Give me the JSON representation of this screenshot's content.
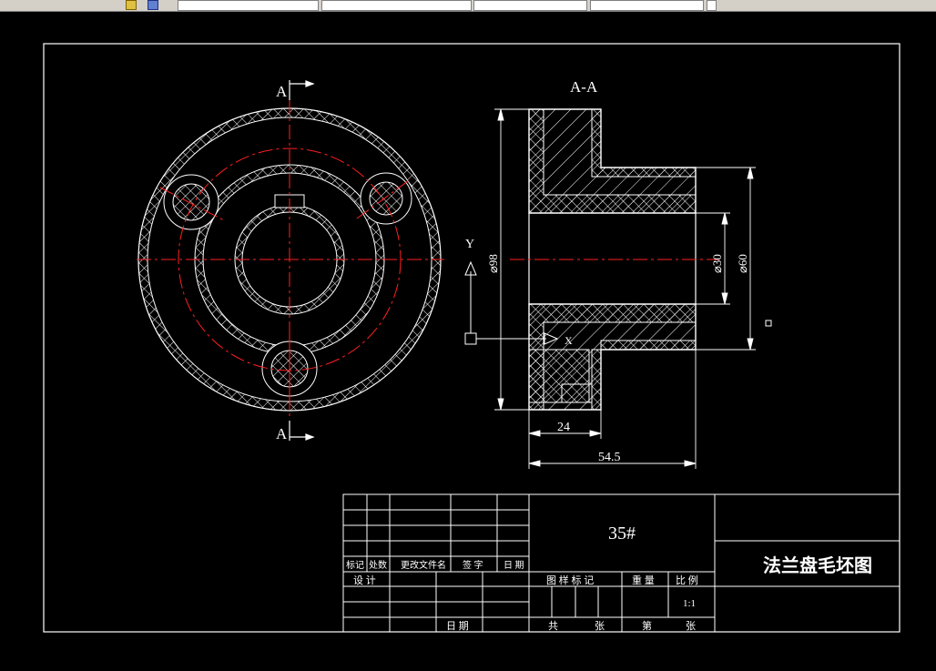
{
  "toolbar": {
    "fields": [
      "",
      "",
      "",
      "",
      ""
    ],
    "icons": [
      "layer-tool-icon",
      "cube-icon"
    ]
  },
  "drawing": {
    "section_label_top": "A",
    "section_label_bottom": "A",
    "section_view_title": "A-A",
    "ucs_y_label": "Y",
    "ucs_x_label": "X",
    "dimensions": {
      "outer_diameter": "⌀98",
      "bore_diameter": "⌀30",
      "hub_diameter": "⌀60",
      "flange_width": "24",
      "total_length": "54.5"
    },
    "colors": {
      "background": "#000000",
      "lines": "#ffffff",
      "centerlines": "#ff0000"
    }
  },
  "title_block": {
    "material": "35#",
    "drawing_name": "法兰盘毛坯图",
    "header_row": [
      "标记",
      "处数",
      "更改文件名",
      "签 字",
      "日 期"
    ],
    "design_label": "设 计",
    "date_label": "日 期",
    "mark_label": "图 样 标 记",
    "weight_label": "重 量",
    "scale_label": "比 例",
    "scale_value": "1:1",
    "total_label": "共",
    "sheet_unit_1": "张",
    "sheet_label": "第",
    "sheet_unit_2": "张"
  }
}
